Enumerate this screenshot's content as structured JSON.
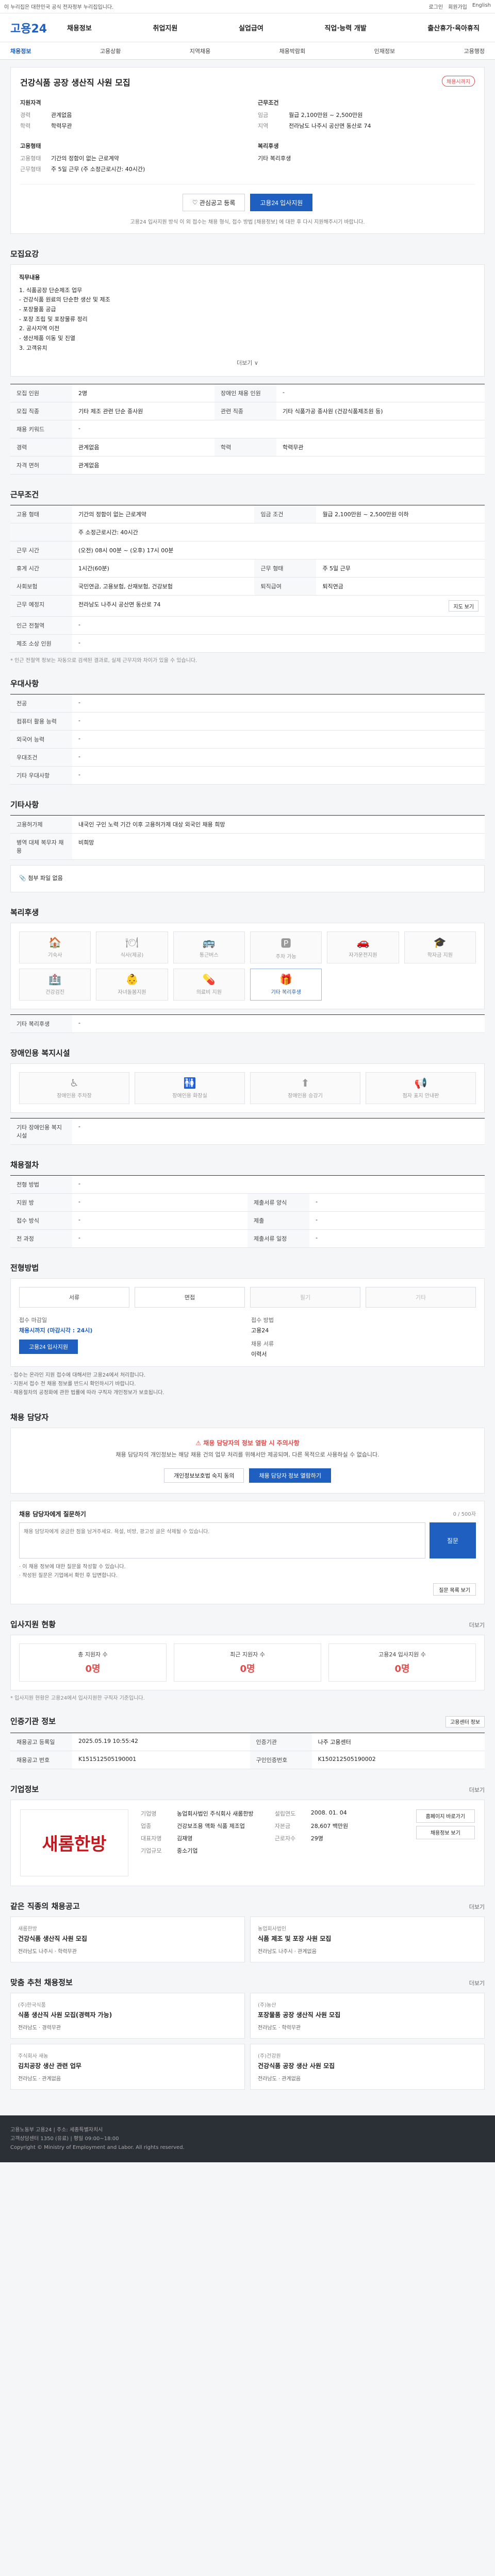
{
  "topbar": {
    "notice": "이 누리집은 대한민국 공식 전자정부 누리집입니다.",
    "utils": [
      "로그인",
      "회원가입",
      "English"
    ]
  },
  "header": {
    "logo": "고용24",
    "gnb": [
      "채용정보",
      "취업지원",
      "실업급여",
      "직업·능력 개발",
      "출산휴가·육아휴직"
    ]
  },
  "subnav": {
    "items": [
      "채용정보",
      "고용상황",
      "지역채용",
      "채용박람회",
      "인재정보",
      "고용행정"
    ],
    "active_index": 0
  },
  "job": {
    "title": "건강식품 공장 생산직 사원 모집",
    "badge": "채용시까지",
    "company_heading": "지원자격",
    "company_rows": [
      {
        "k": "경력",
        "v": "관계없음"
      },
      {
        "k": "학력",
        "v": "학력무관"
      }
    ],
    "cond_heading": "근무조건",
    "cond_rows": [
      {
        "k": "임금",
        "v": "월급 2,100만원 ~ 2,500만원"
      },
      {
        "k": "지역",
        "v": "전라남도 나주시 공산면 동산로 74"
      }
    ],
    "emp_heading": "고용형태",
    "emp_rows": [
      {
        "k": "고용형태",
        "v": "기간의 정함이 없는 근로계약"
      },
      {
        "k": "근무형태",
        "v": "주 5일 근무 (주 소정근로시간: 40시간)"
      }
    ],
    "welfare_heading": "복리후생",
    "welfare_rows": [
      {
        "k": "",
        "v": "기타 복리후생"
      }
    ],
    "scrap_label": "관심공고 등록",
    "apply_label": "고용24 입사지원",
    "notice": "고용24 입사지원 방식 이 외 접수는 채용 형식, 접수 방법 [채용정보] 에 대한 후 다시 지원해주시기 바랍니다."
  },
  "desc": {
    "title": "모집요강",
    "heading": "직무내용",
    "lines": [
      "1. 식품공장 단순제조 업무",
      "- 건강식품 원료의 단순한 생산 및 제조",
      "- 포장물품 공급",
      "- 포장 조립 및 포장물류 정리",
      "2. 공사지역 이전",
      "- 생산제품 이동 및 진열",
      "3. 고객유치"
    ],
    "more": "더보기 ∨"
  },
  "recruit": {
    "rows": [
      {
        "k": "모집 인원",
        "v": "2명",
        "k2": "장애인 채용 인원",
        "v2": "-"
      },
      {
        "k": "모집 직종",
        "v": "기타 제조 관련 단순 종사원",
        "k2": "관련 직종",
        "v2": "기타 식품가공 종사원 (건강식품제조원 등)"
      },
      {
        "k": "채용 키워드",
        "v": "-",
        "k2": "",
        "v2": ""
      },
      {
        "k": "경력",
        "v": "관계없음",
        "k2": "학력",
        "v2": "학력무관"
      },
      {
        "k": "자격 면허",
        "v": "관계없음",
        "k2": "",
        "v2": ""
      }
    ]
  },
  "work": {
    "title": "근무조건",
    "rows": [
      {
        "k": "고용 형태",
        "v": "기간의 정함이 없는 근로계약",
        "k2": "임금 조건",
        "v2": "월급 2,100만원 ~ 2,500만원 이하"
      },
      {
        "k": "",
        "v": "주 소정근로시간: 40시간",
        "k2": "",
        "v2": ""
      },
      {
        "k": "근무 시간",
        "v": "(오전) 08시 00분 ~ (오후) 17시 00분",
        "k2": "",
        "v2": ""
      },
      {
        "k": "휴게 시간",
        "v": "1시간(60분)",
        "k2": "근무 형태",
        "v2": "주 5일 근무"
      },
      {
        "k": "사회보험",
        "v": "국민연금, 고용보험, 산재보험, 건강보험",
        "k2": "퇴직급여",
        "v2": "퇴직연금"
      },
      {
        "k": "근무 예정지",
        "v": "전라남도 나주시 공산면 동산로 74",
        "k2": "",
        "v2": ""
      },
      {
        "k": "인근 전철역",
        "v": "-",
        "k2": "",
        "v2": ""
      },
      {
        "k": "제조 소상 인원",
        "v": "-",
        "k2": "",
        "v2": ""
      }
    ],
    "map_btn": "지도 보기",
    "hint": "* 인근 전철역 정보는 자동으로 검색된 결과로, 실제 근무지와 차이가 있을 수 있습니다."
  },
  "preference": {
    "title": "우대사항",
    "rows": [
      {
        "k": "전공",
        "v": "-"
      },
      {
        "k": "컴퓨터 활용 능력",
        "v": "-"
      },
      {
        "k": "외국어 능력",
        "v": "-"
      },
      {
        "k": "우대조건",
        "v": "-"
      },
      {
        "k": "기타 우대사항",
        "v": "-"
      }
    ]
  },
  "etc": {
    "title": "기타사항",
    "rows": [
      {
        "k": "고용허가제",
        "v": "내국인 구인 노력 기간 이후 고용허가제 대상 외국인 채용 희망"
      },
      {
        "k": "병역 대체 복무자 채용",
        "v": "비희망"
      }
    ],
    "attach": "첨부 파일 없음"
  },
  "welfare": {
    "title": "복리후생",
    "items": [
      {
        "icon": "🏠",
        "label": "기숙사",
        "on": false
      },
      {
        "icon": "🍽",
        "label": "식사(제공)",
        "on": false
      },
      {
        "icon": "🚌",
        "label": "통근버스",
        "on": false
      },
      {
        "icon": "🅿",
        "label": "주차 가능",
        "on": false
      },
      {
        "icon": "🚗",
        "label": "자가운전지원",
        "on": false
      },
      {
        "icon": "🎓",
        "label": "학자금 지원",
        "on": false
      },
      {
        "icon": "🏥",
        "label": "건강검진",
        "on": false
      },
      {
        "icon": "👶",
        "label": "자녀돌봄지원",
        "on": false
      },
      {
        "icon": "💊",
        "label": "의료비 지원",
        "on": false
      },
      {
        "icon": "🎁",
        "label": "기타 복리후생",
        "on": true
      }
    ],
    "extra_title": "기타 복리후생",
    "extra": "-"
  },
  "disabled": {
    "title": "장애인용 복지시설",
    "items": [
      {
        "icon": "♿",
        "label": "장애인용 주차장"
      },
      {
        "icon": "🚻",
        "label": "장애인용 화장실"
      },
      {
        "icon": "⬆",
        "label": "장애인용 승강기"
      },
      {
        "icon": "📢",
        "label": "점자 표지 안내판"
      }
    ],
    "extra_title": "기타 장애인용 복지시설",
    "extra": "-"
  },
  "selection": {
    "title": "채용절차",
    "rows": [
      {
        "k": "전형 방법",
        "v": "-",
        "k2": "",
        "v2": ""
      },
      {
        "k": "지원 방",
        "v": "-",
        "k2": "제출서류 양식",
        "v2": "-"
      },
      {
        "k": "접수 방식",
        "v": "-",
        "k2": "제출",
        "v2": "-"
      },
      {
        "k": "전 과정",
        "v": "-",
        "k2": "제출서류 일정",
        "v2": "-"
      }
    ]
  },
  "method": {
    "title": "전형방법",
    "tabs": [
      {
        "label": "서류",
        "off": false
      },
      {
        "label": "면접",
        "off": false
      },
      {
        "label": "필기",
        "off": true
      },
      {
        "label": "기타",
        "off": true
      }
    ],
    "deadline_label": "접수 마감일",
    "deadline": "채용시까지 (마감시각 : 24시)",
    "apply_label": "고용24 입사지원",
    "method_label": "접수 방법",
    "method_val": "고용24",
    "docs_label": "채용 서류",
    "docs_val": "이력서",
    "notes": [
      "· 접수는 온라인 지원 접수에 대해서만 고용24에서 처리합니다.",
      "· 지원서 접수 전 채용 정보를 반드시 확인하시기 바랍니다.",
      "· 채용절차의 공정화에 관한 법률에 따라 구직자 개인정보가 보호됩니다."
    ]
  },
  "contact": {
    "title": "채용 담당자",
    "warn": "채용 담당자의 정보 열람 시 주의사항",
    "desc": "채용 담당자의 개인정보는 해당 채용 건의 업무 처리를 위해서만 제공되며, 다른 목적으로 사용하실 수 없습니다.",
    "btn_login": "개인정보보호법 숙지 동의",
    "btn_view": "채용 담당자 정보 열람하기"
  },
  "qna": {
    "title": "채용 담당자에게 질문하기",
    "counter": "0 / 500자",
    "placeholder": "채용 담당자에게 궁금한 점을 남겨주세요. 욕설, 비방, 광고성 글은 삭제될 수 있습니다.",
    "submit": "질문",
    "notes": [
      "· 이 채용 정보에 대한 질문을 작성할 수 있습니다.",
      "· 작성된 질문은 기업에서 확인 후 답변합니다."
    ],
    "list_btn": "질문 목록 보기"
  },
  "stats": {
    "title": "입사지원 현황",
    "more": "더보기",
    "items": [
      {
        "label": "총 지원자 수",
        "num": "0명"
      },
      {
        "label": "최근 지원자 수",
        "num": "0명"
      },
      {
        "label": "고용24 입사지원 수",
        "num": "0명"
      }
    ],
    "note": "* 입사지원 현황은 고용24에서 입사지원한 구직자 기준입니다."
  },
  "auth": {
    "title": "인증기관 정보",
    "rows": [
      {
        "k": "채용공고 등록일",
        "v": "2025.05.19 10:55:42",
        "k2": "인증기관",
        "v2": "나주 고용센터"
      },
      {
        "k": "채용공고 번호",
        "v": "K151512505190001",
        "k2": "구인인증번호",
        "v2": "K150212505190002"
      }
    ],
    "btn": "고용센터 정보"
  },
  "corp": {
    "title": "기업정보",
    "more": "더보기",
    "logo_text": "새롬한방",
    "rows": [
      {
        "k": "기업명",
        "v": "농업회사법인 주식회사 새롬한방",
        "k2": "설립연도",
        "v2": "2008. 01. 04"
      },
      {
        "k": "업종",
        "v": "건강보조용 액화 식품 제조업",
        "k2": "자본금",
        "v2": "28,607 백만원"
      },
      {
        "k": "대표자명",
        "v": "김재영",
        "k2": "근로자수",
        "v2": "29명"
      },
      {
        "k": "기업규모",
        "v": "중소기업",
        "k2": "",
        "v2": ""
      }
    ],
    "btn_home": "홈페이지 바로가기",
    "btn_jobs": "채용정보 보기"
  },
  "similar": {
    "title": "같은 직종의 채용공고",
    "more": "더보기",
    "items": [
      {
        "co": "새롬한방",
        "ttl": "건강식품 생산직 사원 모집",
        "meta": "전라남도 나주시 · 학력무관"
      },
      {
        "co": "농업회사법인",
        "ttl": "식품 제조 및 포장 사원 모집",
        "meta": "전라남도 나주시 · 관계없음"
      }
    ]
  },
  "recommend": {
    "title": "맞춤 추천 채용정보",
    "more": "더보기",
    "items": [
      {
        "co": "(주)한국식품",
        "ttl": "식품 생산직 사원 모집(경력자 가능)",
        "meta": "전라남도 · 경력무관"
      },
      {
        "co": "(주)농산",
        "ttl": "포장물품 공장 생산직 사원 모집",
        "meta": "전라남도 · 학력무관"
      },
      {
        "co": "주식회사 새농",
        "ttl": "김치공장 생산 관련 업무",
        "meta": "전라남도 · 관계없음"
      },
      {
        "co": "(주)건강원",
        "ttl": "건강식품 공장 생산 사원 모집",
        "meta": "전라남도 · 관계없음"
      }
    ]
  },
  "footer": {
    "lines": [
      "고용노동부 고용24 | 주소: 세종특별자치시",
      "고객상담센터 1350 (유료) | 평일 09:00~18:00",
      "Copyright © Ministry of Employment and Labor. All rights reserved."
    ]
  }
}
